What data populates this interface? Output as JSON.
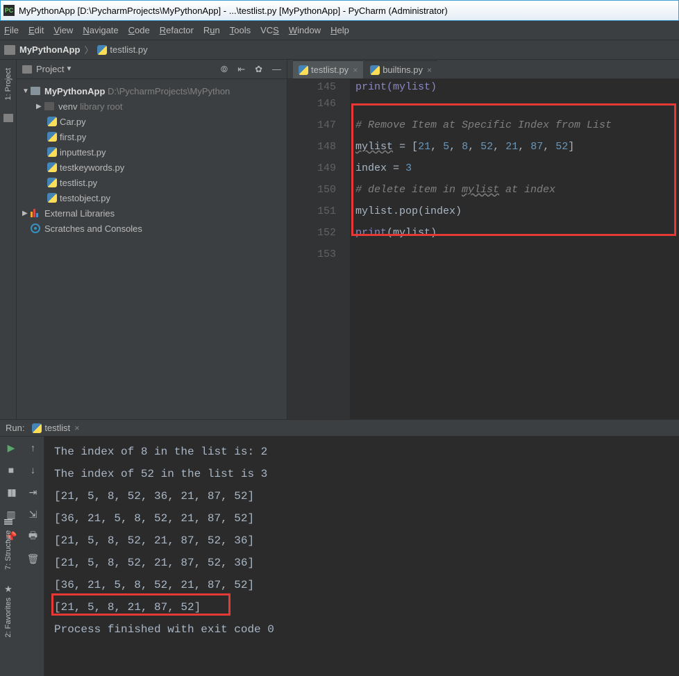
{
  "window": {
    "title": "MyPythonApp [D:\\PycharmProjects\\MyPythonApp] - ...\\testlist.py [MyPythonApp] - PyCharm (Administrator)"
  },
  "menu": {
    "file": "File",
    "edit": "Edit",
    "view": "View",
    "navigate": "Navigate",
    "code": "Code",
    "refactor": "Refactor",
    "run": "Run",
    "tools": "Tools",
    "vcs": "VCS",
    "window": "Window",
    "help": "Help"
  },
  "breadcrumb": {
    "project": "MyPythonApp",
    "file": "testlist.py"
  },
  "sidebar": {
    "project_label": "1: Project"
  },
  "sidebar_bottom": {
    "structure": "7: Structure",
    "favorites": "2: Favorites"
  },
  "project_panel": {
    "title": "Project",
    "root": "MyPythonApp",
    "root_path": "D:\\PycharmProjects\\MyPython",
    "venv": "venv",
    "venv_meta": "library root",
    "files": [
      "Car.py",
      "first.py",
      "inputtest.py",
      "testkeywords.py",
      "testlist.py",
      "testobject.py"
    ],
    "external": "External Libraries",
    "scratches": "Scratches and Consoles"
  },
  "editor": {
    "tabs": [
      {
        "label": "testlist.py",
        "active": true
      },
      {
        "label": "builtins.py",
        "active": false
      }
    ],
    "gutter_start_partial": "145",
    "lines": [
      {
        "n": "146",
        "html": ""
      },
      {
        "n": "147",
        "html": "<span class='c-comment'># Remove Item at Specific Index from List</span>"
      },
      {
        "n": "148",
        "html": "<span class='c-wavy'>mylist</span> <span class='c-op'>=</span> [<span class='c-num'>21</span>, <span class='c-num'>5</span>, <span class='c-num'>8</span>, <span class='c-num'>52</span>, <span class='c-num'>21</span>, <span class='c-num'>87</span>, <span class='c-num'>52</span>]"
      },
      {
        "n": "149",
        "html": "index <span class='c-op'>=</span> <span class='c-num'>3</span>"
      },
      {
        "n": "150",
        "html": "<span class='c-comment'># delete item in <span class='c-wavy'>mylist</span> at index</span>"
      },
      {
        "n": "151",
        "html": "mylist.pop(index)"
      },
      {
        "n": "152",
        "html": "<span class='c-builtin'>print</span>(mylist)"
      },
      {
        "n": "153",
        "html": ""
      }
    ],
    "top_partial_code": "print(mylist)"
  },
  "run": {
    "label": "Run:",
    "config": "testlist",
    "output": [
      "The index of 8 in the list is: 2",
      "The index of 52 in the list is 3",
      "[21, 5, 8, 52, 36, 21, 87, 52]",
      "[36, 21, 5, 8, 52, 21, 87, 52]",
      "[21, 5, 8, 52, 21, 87, 52, 36]",
      "[21, 5, 8, 52, 21, 87, 52, 36]",
      "[36, 21, 5, 8, 52, 21, 87, 52]",
      "[21, 5, 8, 21, 87, 52]",
      "",
      "Process finished with exit code 0"
    ]
  }
}
